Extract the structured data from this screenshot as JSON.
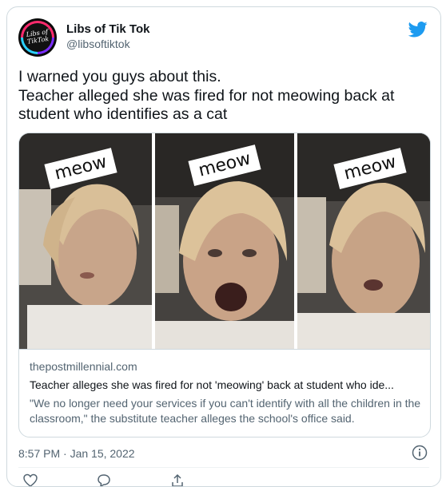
{
  "author": {
    "display_name": "Libs of Tik Tok",
    "handle": "@libsoftiktok",
    "avatar_text": "Libs of TikTok"
  },
  "tweet": {
    "text": "I warned you guys about this.\nTeacher alleged she was fired for not meowing back at student who identifies as a cat"
  },
  "link_card": {
    "thumbnails": [
      {
        "caption": "meow"
      },
      {
        "caption": "meow"
      },
      {
        "caption": "meow"
      }
    ],
    "domain": "thepostmillennial.com",
    "headline": "Teacher alleges she was fired for not 'meowing' back at student who ide...",
    "description": "\"We no longer need your services if you can't identify with all the children in the classroom,\" the substitute teacher alleges the school's office said."
  },
  "footer": {
    "timestamp": "8:57 PM · Jan 15, 2022"
  },
  "icons": {
    "brand": "twitter-bird-icon",
    "info": "info-icon",
    "actions": [
      "heart-icon",
      "reply-icon",
      "share-icon"
    ]
  },
  "colors": {
    "twitter_blue": "#1d9bf0",
    "secondary_text": "#536471",
    "border": "#cfd9de"
  }
}
